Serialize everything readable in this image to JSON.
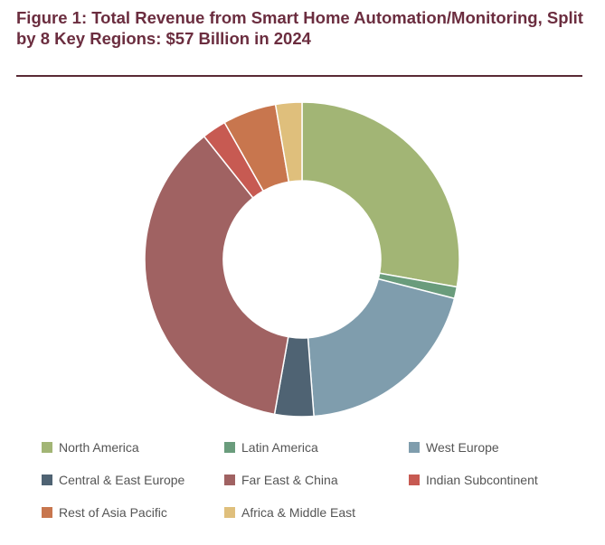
{
  "chart_data": {
    "type": "donut",
    "title": "Figure 1: Total Revenue from Smart Home Automation/Monitoring, Split by 8 Key Regions: $57 Billion in 2024",
    "legend_position": "bottom",
    "categories": [
      "North America",
      "Latin America",
      "West Europe",
      "Central & East Europe",
      "Far East & China",
      "Indian Subcontinent",
      "Rest of Asia Pacific",
      "Africa & Middle East"
    ],
    "values": [
      27.8,
      1.2,
      19.8,
      4.0,
      36.5,
      2.5,
      5.5,
      2.7
    ],
    "unit": "%",
    "colors": [
      "#a2b575",
      "#6a9c7c",
      "#7f9dad",
      "#4f6373",
      "#a06262",
      "#c75a52",
      "#c8764e",
      "#dfbf7c"
    ]
  }
}
